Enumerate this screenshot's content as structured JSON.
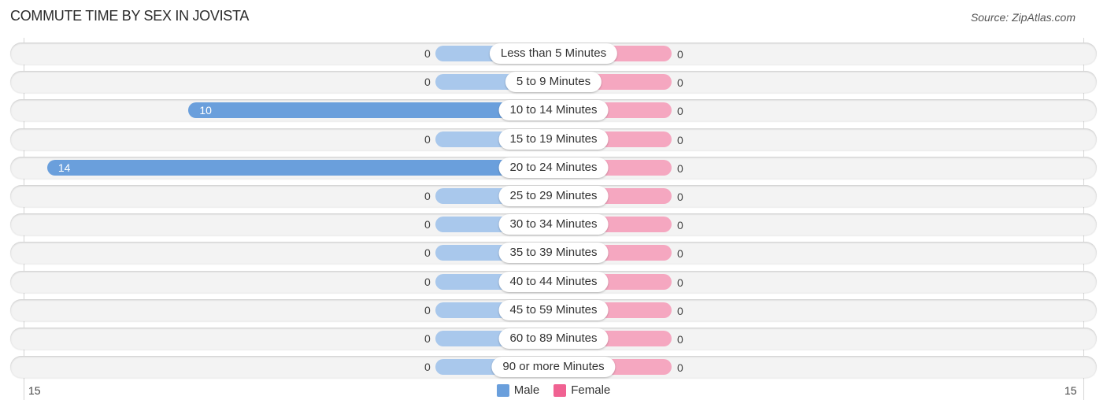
{
  "title": "COMMUTE TIME BY SEX IN JOVISTA",
  "source": "Source: ZipAtlas.com",
  "colors": {
    "male": "#6a9fdc",
    "male_light": "#a9c8ec",
    "female": "#f06292",
    "female_light": "#f5a7c0"
  },
  "chart_data": {
    "type": "bar",
    "orientation": "horizontal-diverging",
    "title": "COMMUTE TIME BY SEX IN JOVISTA",
    "categories": [
      "Less than 5 Minutes",
      "5 to 9 Minutes",
      "10 to 14 Minutes",
      "15 to 19 Minutes",
      "20 to 24 Minutes",
      "25 to 29 Minutes",
      "30 to 34 Minutes",
      "35 to 39 Minutes",
      "40 to 44 Minutes",
      "45 to 59 Minutes",
      "60 to 89 Minutes",
      "90 or more Minutes"
    ],
    "series": [
      {
        "name": "Male",
        "values": [
          0,
          0,
          10,
          0,
          14,
          0,
          0,
          0,
          0,
          0,
          0,
          0
        ]
      },
      {
        "name": "Female",
        "values": [
          0,
          0,
          0,
          0,
          0,
          0,
          0,
          0,
          0,
          0,
          0,
          0
        ]
      }
    ],
    "xlim": [
      -15,
      15
    ],
    "axis_tick_labels": {
      "left": "15",
      "right": "15"
    },
    "legend": {
      "placement": "bottom-center",
      "entries": [
        "Male",
        "Female"
      ]
    },
    "grid": false
  }
}
